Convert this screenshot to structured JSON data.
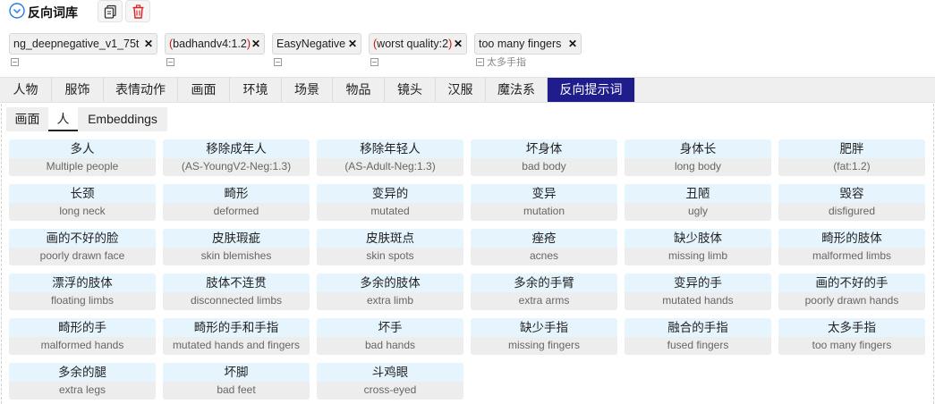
{
  "header": {
    "title": "反向词库"
  },
  "tags": [
    {
      "text": "ng_deepnegative_v1_75t",
      "red": false,
      "sub": ""
    },
    {
      "text": "(badhandv4:1.2)",
      "red": true,
      "sub": ""
    },
    {
      "text": "EasyNegative",
      "red": false,
      "sub": ""
    },
    {
      "text": "(worst quality:2)",
      "red": true,
      "sub": ""
    },
    {
      "text": "too many fingers",
      "red": false,
      "sub": "太多手指"
    }
  ],
  "category_tabs": [
    "人物",
    "服饰",
    "表情动作",
    "画面",
    "环境",
    "场景",
    "物品",
    "镜头",
    "汉服",
    "魔法系",
    "反向提示词"
  ],
  "active_category": "反向提示词",
  "sub_tabs": [
    "画面",
    "人",
    "Embeddings"
  ],
  "active_sub_tab": "人",
  "cards": [
    {
      "cn": "多人",
      "en": "Multiple people"
    },
    {
      "cn": "移除成年人",
      "en": "(AS-YoungV2-Neg:1.3)"
    },
    {
      "cn": "移除年轻人",
      "en": "(AS-Adult-Neg:1.3)"
    },
    {
      "cn": "坏身体",
      "en": "bad body"
    },
    {
      "cn": "身体长",
      "en": "long body"
    },
    {
      "cn": "肥胖",
      "en": "(fat:1.2)"
    },
    {
      "cn": "长颈",
      "en": "long neck"
    },
    {
      "cn": "畸形",
      "en": "deformed"
    },
    {
      "cn": "变异的",
      "en": "mutated"
    },
    {
      "cn": "变异",
      "en": "mutation"
    },
    {
      "cn": "丑陋",
      "en": "ugly"
    },
    {
      "cn": "毁容",
      "en": "disfigured"
    },
    {
      "cn": "画的不好的脸",
      "en": "poorly drawn face"
    },
    {
      "cn": "皮肤瑕疵",
      "en": "skin blemishes"
    },
    {
      "cn": "皮肤斑点",
      "en": "skin spots"
    },
    {
      "cn": "痤疮",
      "en": "acnes"
    },
    {
      "cn": "缺少肢体",
      "en": "missing limb"
    },
    {
      "cn": "畸形的肢体",
      "en": "malformed limbs"
    },
    {
      "cn": "漂浮的肢体",
      "en": "floating limbs"
    },
    {
      "cn": "肢体不连贯",
      "en": "disconnected limbs"
    },
    {
      "cn": "多余的肢体",
      "en": "extra limb"
    },
    {
      "cn": "多余的手臂",
      "en": "extra arms"
    },
    {
      "cn": "变异的手",
      "en": "mutated hands"
    },
    {
      "cn": "画的不好的手",
      "en": "poorly drawn hands"
    },
    {
      "cn": "畸形的手",
      "en": "malformed hands"
    },
    {
      "cn": "畸形的手和手指",
      "en": "mutated hands and fingers"
    },
    {
      "cn": "坏手",
      "en": "bad hands"
    },
    {
      "cn": "缺少手指",
      "en": "missing fingers"
    },
    {
      "cn": "融合的手指",
      "en": "fused fingers"
    },
    {
      "cn": "太多手指",
      "en": "too many fingers"
    },
    {
      "cn": "多余的腿",
      "en": "extra legs"
    },
    {
      "cn": "坏脚",
      "en": "bad feet"
    },
    {
      "cn": "斗鸡眼",
      "en": "cross-eyed"
    }
  ],
  "colors": {
    "active_tab": "#1f1d8c",
    "card_top": "#e5f4fd",
    "card_bottom": "#ededed",
    "tag_red": "#cc1111",
    "delete_icon": "#e02020",
    "collapse_icon": "#2c7be5"
  }
}
